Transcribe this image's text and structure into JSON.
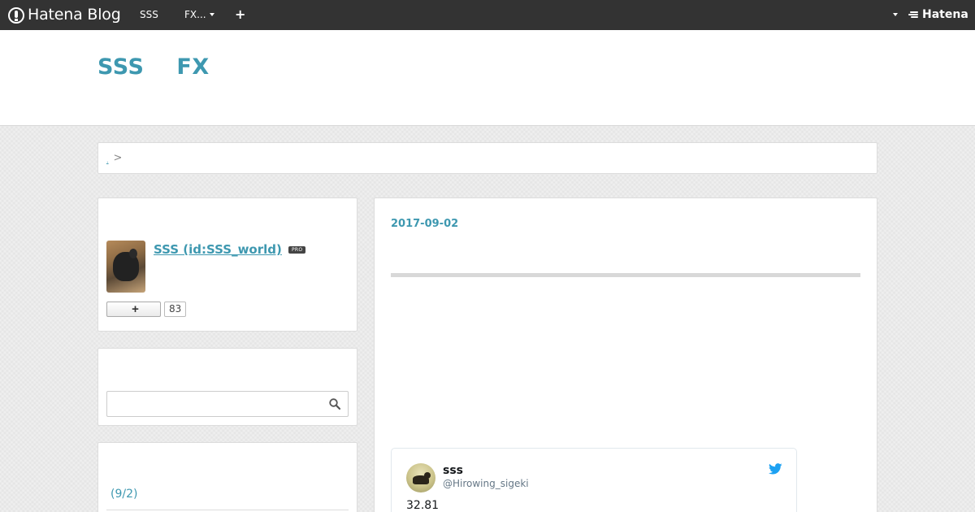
{
  "global_header": {
    "logo_text": "Hatena Blog",
    "blog_link": "SSS",
    "fx_menu": "FX...",
    "add_label": "+",
    "hatena_label": "Hatena"
  },
  "blog": {
    "title_words": [
      "SSS",
      "FX"
    ]
  },
  "breadcrumb": {
    "link": ".",
    "separator": ">"
  },
  "profile": {
    "name": "SSS (id:SSS_world)",
    "badge": "PRO",
    "follow_label": "+",
    "follower_count": "83"
  },
  "search": {
    "value": "",
    "placeholder": ""
  },
  "archive": {
    "link": "(9/2)"
  },
  "entry": {
    "date": "2017-09-02"
  },
  "tweet": {
    "name": "sss",
    "handle": "@Hirowing_sigeki",
    "text": "32.81"
  },
  "colors": {
    "header_bg": "#333333",
    "accent": "#3e98b0",
    "twitter_blue": "#1da1f2"
  },
  "icons": [
    "hatena-blog-logo-icon",
    "caret-down-icon",
    "plus-icon",
    "hatena-mark-icon",
    "search-icon",
    "twitter-bird-icon"
  ]
}
